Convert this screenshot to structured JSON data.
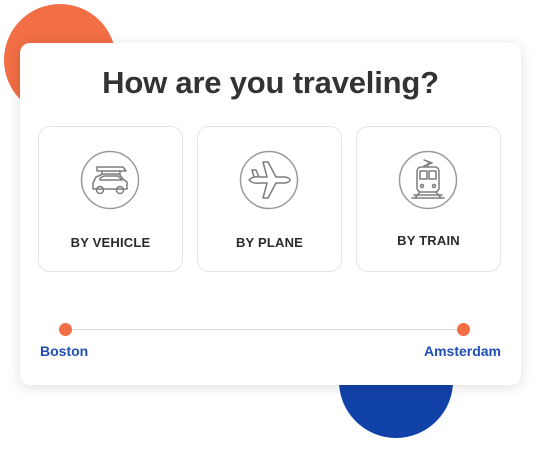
{
  "heading": "How are you traveling?",
  "options": [
    {
      "label": "BY VEHICLE",
      "icon": "car-icon"
    },
    {
      "label": "BY PLANE",
      "icon": "plane-icon"
    },
    {
      "label": "BY TRAIN",
      "icon": "train-icon"
    }
  ],
  "route": {
    "origin": "Boston",
    "destination": "Amsterdam"
  },
  "colors": {
    "accent_orange": "#f26e45",
    "accent_blue": "#1142a8",
    "city_text": "#1e4fb0",
    "heading_text": "#333333"
  }
}
